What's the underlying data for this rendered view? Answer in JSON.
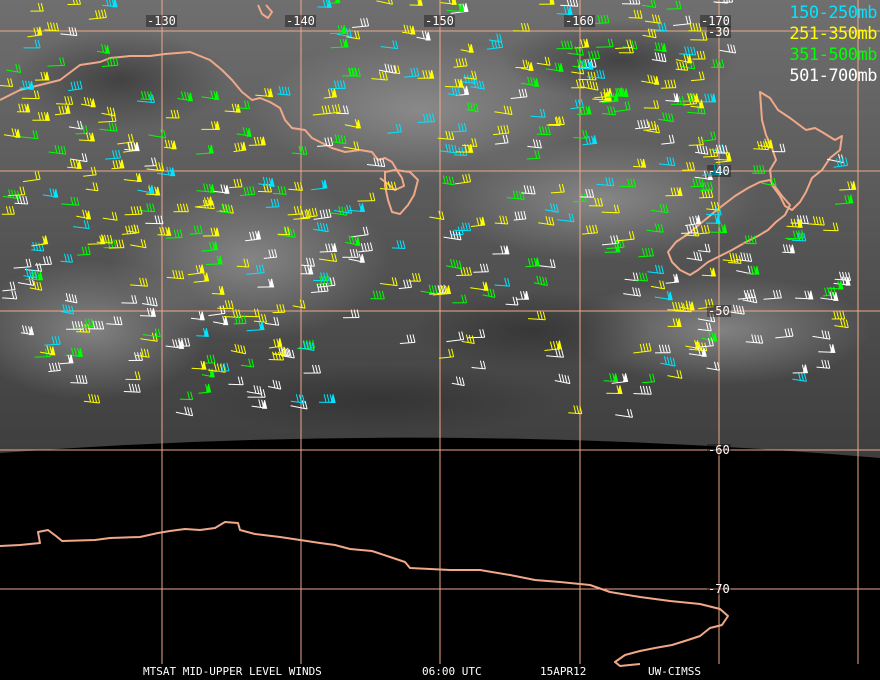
{
  "map": {
    "longitude_labels": [
      "-130",
      "-140",
      "-150",
      "-160",
      "-170"
    ],
    "latitude_labels": [
      "-30",
      "-40",
      "-50",
      "-60",
      "-70"
    ],
    "colors": {
      "grid": "#f0a888",
      "coastline": "#f0a888",
      "night": "#000000",
      "level_150_250": "#00e5ff",
      "level_251_350": "#ffff00",
      "level_351_500": "#00ff00",
      "level_501_700": "#ffffff"
    }
  },
  "legend": {
    "items": [
      {
        "label": "150-250mb",
        "color": "#00e5ff"
      },
      {
        "label": "251-350mb",
        "color": "#ffff00"
      },
      {
        "label": "351-500mb",
        "color": "#00ff00"
      },
      {
        "label": "501-700mb",
        "color": "#ffffff"
      }
    ]
  },
  "footer": {
    "product": "MTSAT MID-UPPER LEVEL WINDS",
    "time": "06:00 UTC",
    "date": "15APR12",
    "source": "UW-CIMSS"
  }
}
